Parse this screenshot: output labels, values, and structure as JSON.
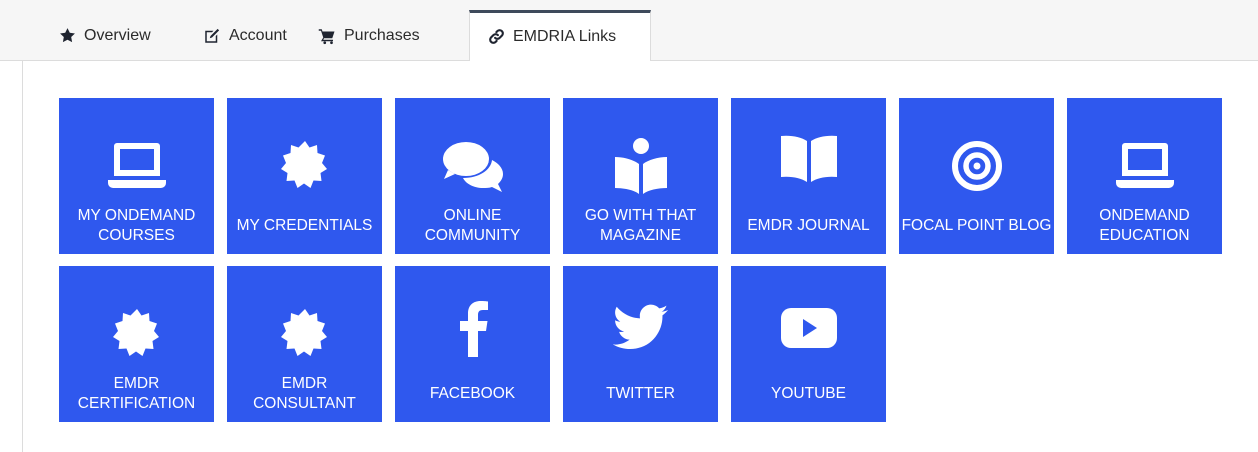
{
  "tabs": [
    {
      "label": "Overview",
      "icon": "star-icon"
    },
    {
      "label": "Account",
      "icon": "edit-icon"
    },
    {
      "label": "Purchases",
      "icon": "cart-icon"
    },
    {
      "label": "EMDRIA Links",
      "icon": "link-icon",
      "active": true
    }
  ],
  "colors": {
    "tile_blue": "#2f58ee",
    "active_tab_border": "#3e4a5b"
  },
  "tiles": [
    {
      "label": "MY ONDEMAND COURSES",
      "icon": "laptop-icon"
    },
    {
      "label": "MY CREDENTIALS",
      "icon": "certificate-icon"
    },
    {
      "label": "ONLINE COMMUNITY",
      "icon": "comments-icon"
    },
    {
      "label": "GO WITH THAT MAGAZINE",
      "icon": "reader-icon"
    },
    {
      "label": "EMDR JOURNAL",
      "icon": "book-open-icon"
    },
    {
      "label": "FOCAL POINT BLOG",
      "icon": "target-icon"
    },
    {
      "label": "ONDEMAND EDUCATION",
      "icon": "laptop-icon"
    },
    {
      "label": "EMDR CERTIFICATION",
      "icon": "certificate-icon"
    },
    {
      "label": "EMDR CONSULTANT",
      "icon": "certificate-icon"
    },
    {
      "label": "FACEBOOK",
      "icon": "facebook-icon"
    },
    {
      "label": "TWITTER",
      "icon": "twitter-icon"
    },
    {
      "label": "YOUTUBE",
      "icon": "youtube-icon"
    }
  ]
}
